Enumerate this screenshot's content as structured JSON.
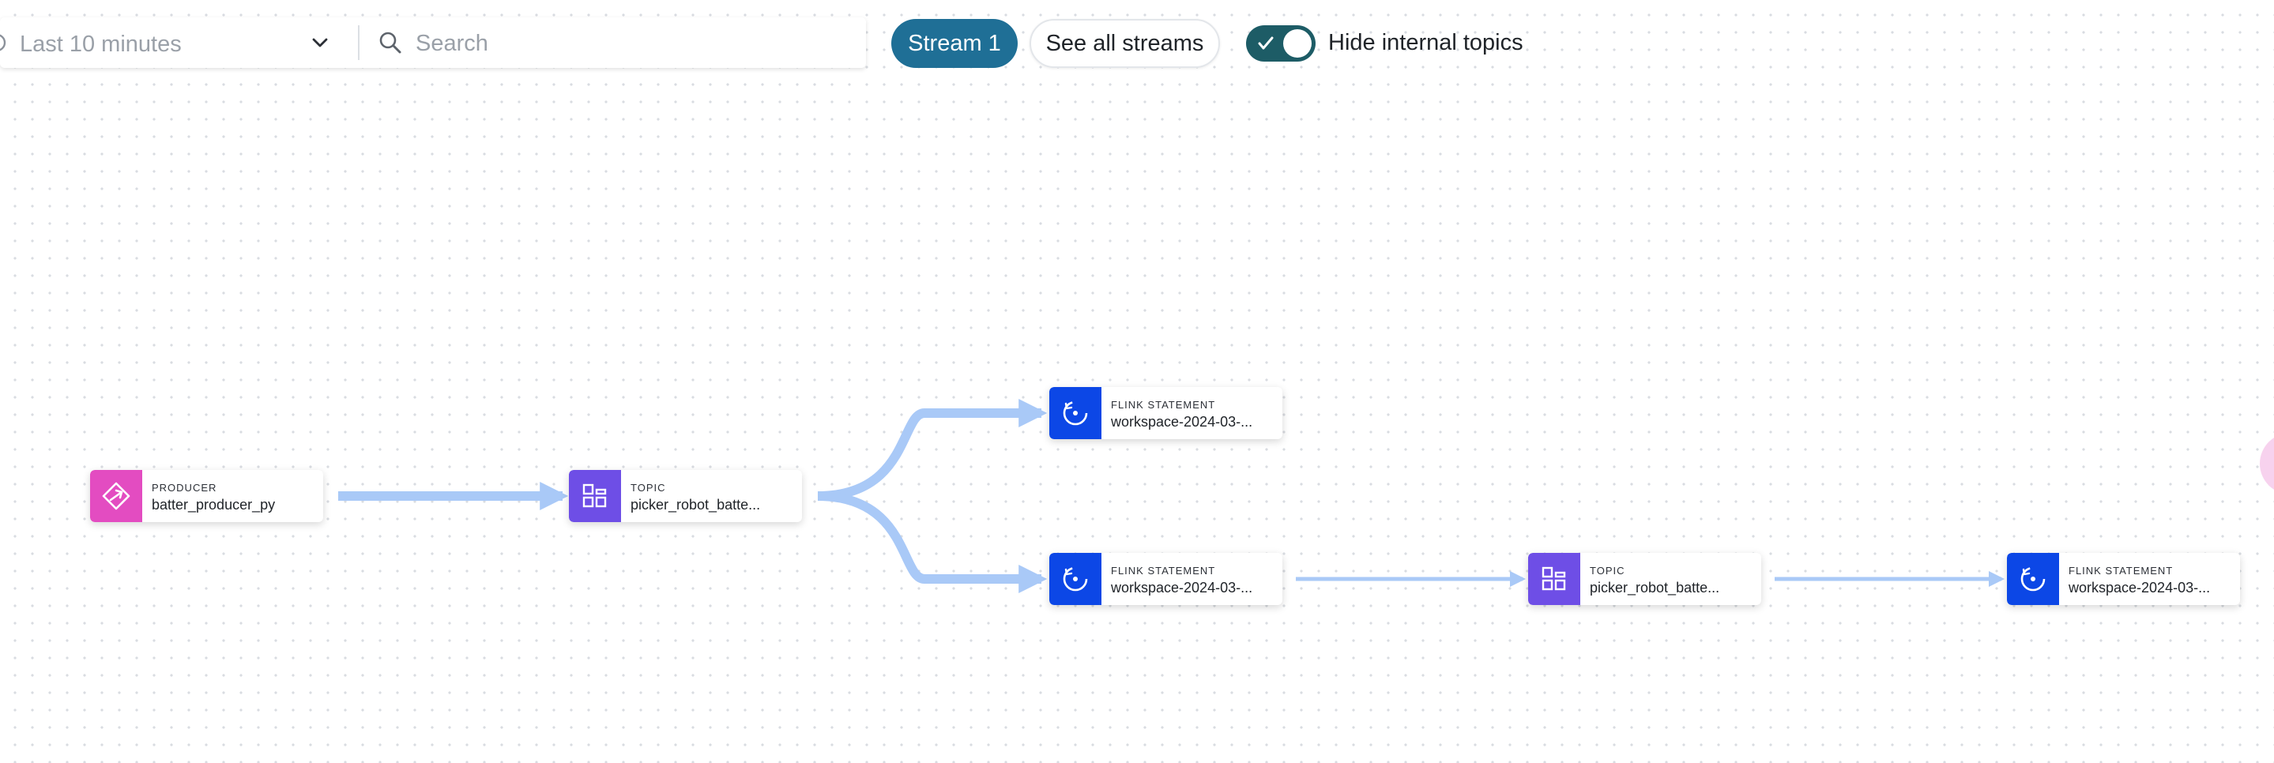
{
  "toolbar": {
    "time_range": "Last 10 minutes",
    "search_placeholder": "Search",
    "stream_button": "Stream 1",
    "see_all_button": "See all streams",
    "hide_internal_label": "Hide internal topics",
    "hide_internal_enabled": true
  },
  "icons": {
    "time": "clock-icon",
    "time_dropdown": "chevron-down-icon",
    "search": "search-icon",
    "toggle": "check-icon",
    "producer": "producer-icon",
    "topic": "topic-grid-icon",
    "flink": "flink-statement-icon"
  },
  "colors": {
    "producer": "#e34cc1",
    "topic": "#6e4ee6",
    "flink": "#0c47e6",
    "edge": "#a9c9f7",
    "primary_button": "#1f6f96",
    "toggle": "#1d5c66"
  },
  "nodes": [
    {
      "id": "producer-1",
      "type": "PRODUCER",
      "name": "batter_producer_py"
    },
    {
      "id": "topic-1",
      "type": "TOPIC",
      "name": "picker_robot_batte..."
    },
    {
      "id": "flink-1",
      "type": "FLINK STATEMENT",
      "name": "workspace-2024-03-..."
    },
    {
      "id": "flink-2",
      "type": "FLINK STATEMENT",
      "name": "workspace-2024-03-..."
    },
    {
      "id": "topic-2",
      "type": "TOPIC",
      "name": "picker_robot_batte..."
    },
    {
      "id": "flink-3",
      "type": "FLINK STATEMENT",
      "name": "workspace-2024-03-..."
    }
  ]
}
